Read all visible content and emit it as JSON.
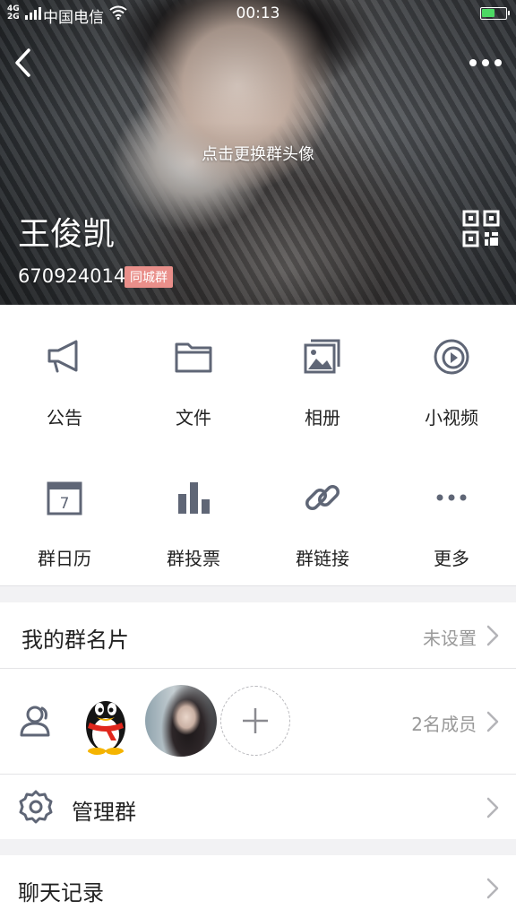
{
  "status_bar": {
    "network_top": "4G",
    "network_bottom": "2G",
    "carrier": "中国电信",
    "time": "00:13",
    "battery_percent": 55,
    "battery_color": "#4cd964"
  },
  "header": {
    "back_icon": "chevron-left-icon",
    "more_icon": "more-dots-icon",
    "change_avatar_hint": "点击更换群头像",
    "group_name": "王俊凯",
    "group_id": "670924014",
    "group_tag": "同城群",
    "group_tag_color": "#e98f8a",
    "qr_icon": "qr-code-icon"
  },
  "features": [
    {
      "label": "公告",
      "icon": "megaphone-icon"
    },
    {
      "label": "文件",
      "icon": "folder-icon"
    },
    {
      "label": "相册",
      "icon": "photo-album-icon"
    },
    {
      "label": "小视频",
      "icon": "video-play-icon"
    },
    {
      "label": "群日历",
      "icon": "calendar-icon",
      "calendar_day": "7"
    },
    {
      "label": "群投票",
      "icon": "bar-chart-icon"
    },
    {
      "label": "群链接",
      "icon": "link-icon"
    },
    {
      "label": "更多",
      "icon": "more-horizontal-icon"
    }
  ],
  "card": {
    "title": "我的群名片",
    "value": "未设置"
  },
  "members": {
    "count_label": "2名成员",
    "icon": "members-icon",
    "add_icon": "plus-icon"
  },
  "manage": {
    "title": "管理群",
    "icon": "gear-icon"
  },
  "chat_history": {
    "title": "聊天记录"
  },
  "colors": {
    "icon_gray": "#5f6676",
    "chevron_gray": "#b4b4b8",
    "hint_gray": "#999999"
  }
}
